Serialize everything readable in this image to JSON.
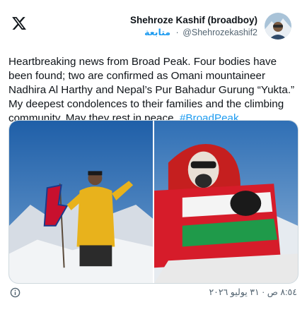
{
  "header": {
    "display_name": "Shehroze Kashif (broadboy)",
    "follow_label": "متابعة",
    "handle": "@Shehrozekashif2"
  },
  "tweet": {
    "text": "Heartbreaking news from Broad Peak. Four bodies have been found; two are confirmed as Omani mountaineer Nadhira Al Harthy and Nepal’s Pur Bahadur Gurung “Yukta.” My deepest condolences to their families and the climbing community. May they rest in peace. ",
    "hashtag": "#BroadPeak"
  },
  "media": {
    "photos": [
      {
        "icon": "climber-nepal-flag-photo"
      },
      {
        "icon": "climber-oman-flag-photo"
      }
    ]
  },
  "footer": {
    "timestamp": "٨:٥٤ ص · ٣١ يوليو ٢٠٢٦",
    "info_icon": "info-icon"
  },
  "colors": {
    "accent": "#1d9bf0",
    "text": "#0f1419",
    "secondary": "#536471"
  }
}
